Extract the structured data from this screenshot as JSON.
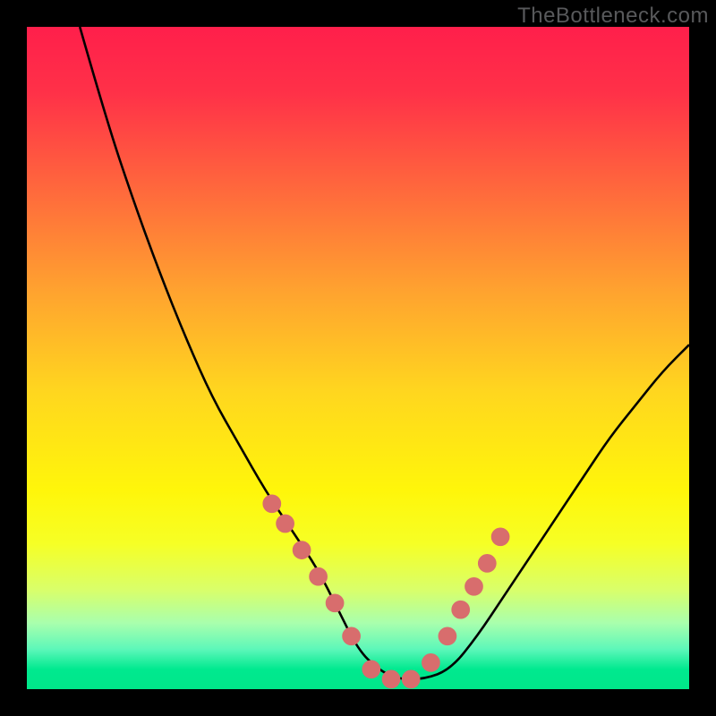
{
  "attribution": "TheBottleneck.com",
  "colors": {
    "frame": "#000000",
    "curve_stroke": "#000000",
    "marker_fill": "#d86d6d",
    "marker_stroke": "#d86d6d"
  },
  "chart_data": {
    "type": "line",
    "title": "",
    "xlabel": "",
    "ylabel": "",
    "xlim": [
      0,
      100
    ],
    "ylim": [
      0,
      100
    ],
    "grid": false,
    "legend": false,
    "background_gradient_stops": [
      {
        "offset": 0.0,
        "color": "#ff1f4b"
      },
      {
        "offset": 0.1,
        "color": "#ff3148"
      },
      {
        "offset": 0.25,
        "color": "#ff6a3c"
      },
      {
        "offset": 0.4,
        "color": "#ffa32f"
      },
      {
        "offset": 0.55,
        "color": "#ffd61f"
      },
      {
        "offset": 0.7,
        "color": "#fff60a"
      },
      {
        "offset": 0.78,
        "color": "#f6ff25"
      },
      {
        "offset": 0.85,
        "color": "#d9ff6a"
      },
      {
        "offset": 0.9,
        "color": "#a9ffad"
      },
      {
        "offset": 0.94,
        "color": "#5cf7b9"
      },
      {
        "offset": 0.97,
        "color": "#00e98f"
      },
      {
        "offset": 1.0,
        "color": "#00e789"
      }
    ],
    "series": [
      {
        "name": "curve",
        "type": "line",
        "x": [
          8,
          12,
          16,
          20,
          24,
          28,
          32,
          36,
          40,
          44,
          47,
          50,
          53,
          56,
          60,
          64,
          68,
          72,
          76,
          80,
          84,
          88,
          92,
          96,
          100
        ],
        "y": [
          100,
          86,
          74,
          63,
          53,
          44,
          37,
          30,
          24,
          18,
          12,
          6,
          3,
          1.5,
          1.5,
          3,
          8,
          14,
          20,
          26,
          32,
          38,
          43,
          48,
          52
        ]
      },
      {
        "name": "markers",
        "type": "scatter",
        "x": [
          37,
          39,
          41.5,
          44,
          46.5,
          49,
          52,
          55,
          58,
          61,
          63.5,
          65.5,
          67.5,
          69.5,
          71.5
        ],
        "y": [
          28,
          25,
          21,
          17,
          13,
          8,
          3,
          1.5,
          1.5,
          4,
          8,
          12,
          15.5,
          19,
          23
        ]
      }
    ]
  }
}
